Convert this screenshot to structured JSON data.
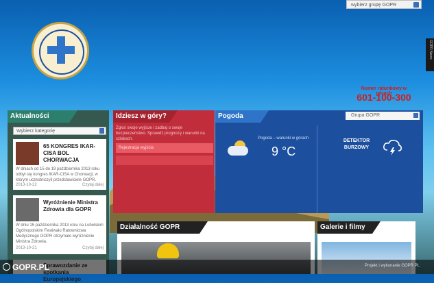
{
  "top": {
    "group_select": "wybierz grupę GOPR",
    "side_tab": "GOPR News"
  },
  "rescue": {
    "label": "Numer ratunkowy w górach",
    "number": "601-100-300"
  },
  "news": {
    "title": "Aktualności",
    "category_placeholder": "Wybierz kategorię",
    "items": [
      {
        "title": "65 KONGRES IKAR-CISA BOL CHORWACJA",
        "text": "W dniach od 15 do 19 października 2013 roku odbył się kongres IKAR-CISA w Chorwacji, w którym uczestniczyli przedstawiciele GOPR.",
        "date": "2013-10-22",
        "more": "Czytaj dalej"
      },
      {
        "title": "Wyróżnienie Ministra Zdrowia dla GOPR",
        "text": "W dniu 15 października 2013 roku na Lubelskim Ogólnopolskim Festiwalu Ratownictwa Medycznego GOPR otrzymało wyróżnienie Ministra Zdrowia.",
        "date": "2013-10-21",
        "more": "Czytaj dalej"
      },
      {
        "title": "Sprawozdanie ze spotkania Europejskiego",
        "text": "",
        "date": "",
        "more": ""
      }
    ]
  },
  "mountains": {
    "title": "Idziesz w góry?",
    "text": "Zgłoś swoje wyjście i zadbaj o swoje bezpieczeństwo. Sprawdź prognozę i warunki na szlakach.",
    "panel_label": "Rejestracja wyjścia"
  },
  "weather": {
    "title": "Pogoda",
    "select": "Grupa GOPR",
    "label": "Pogoda – warunki w górach",
    "temperature": "9 °C",
    "detector": "DETEKTOR BURZOWY"
  },
  "activity": {
    "title": "Działalność GOPR"
  },
  "gallery": {
    "title": "Galerie i filmy"
  },
  "bottom": {
    "logo": "GOPR.PL",
    "right_text": "Projekt i wykonanie GOPR PL"
  }
}
